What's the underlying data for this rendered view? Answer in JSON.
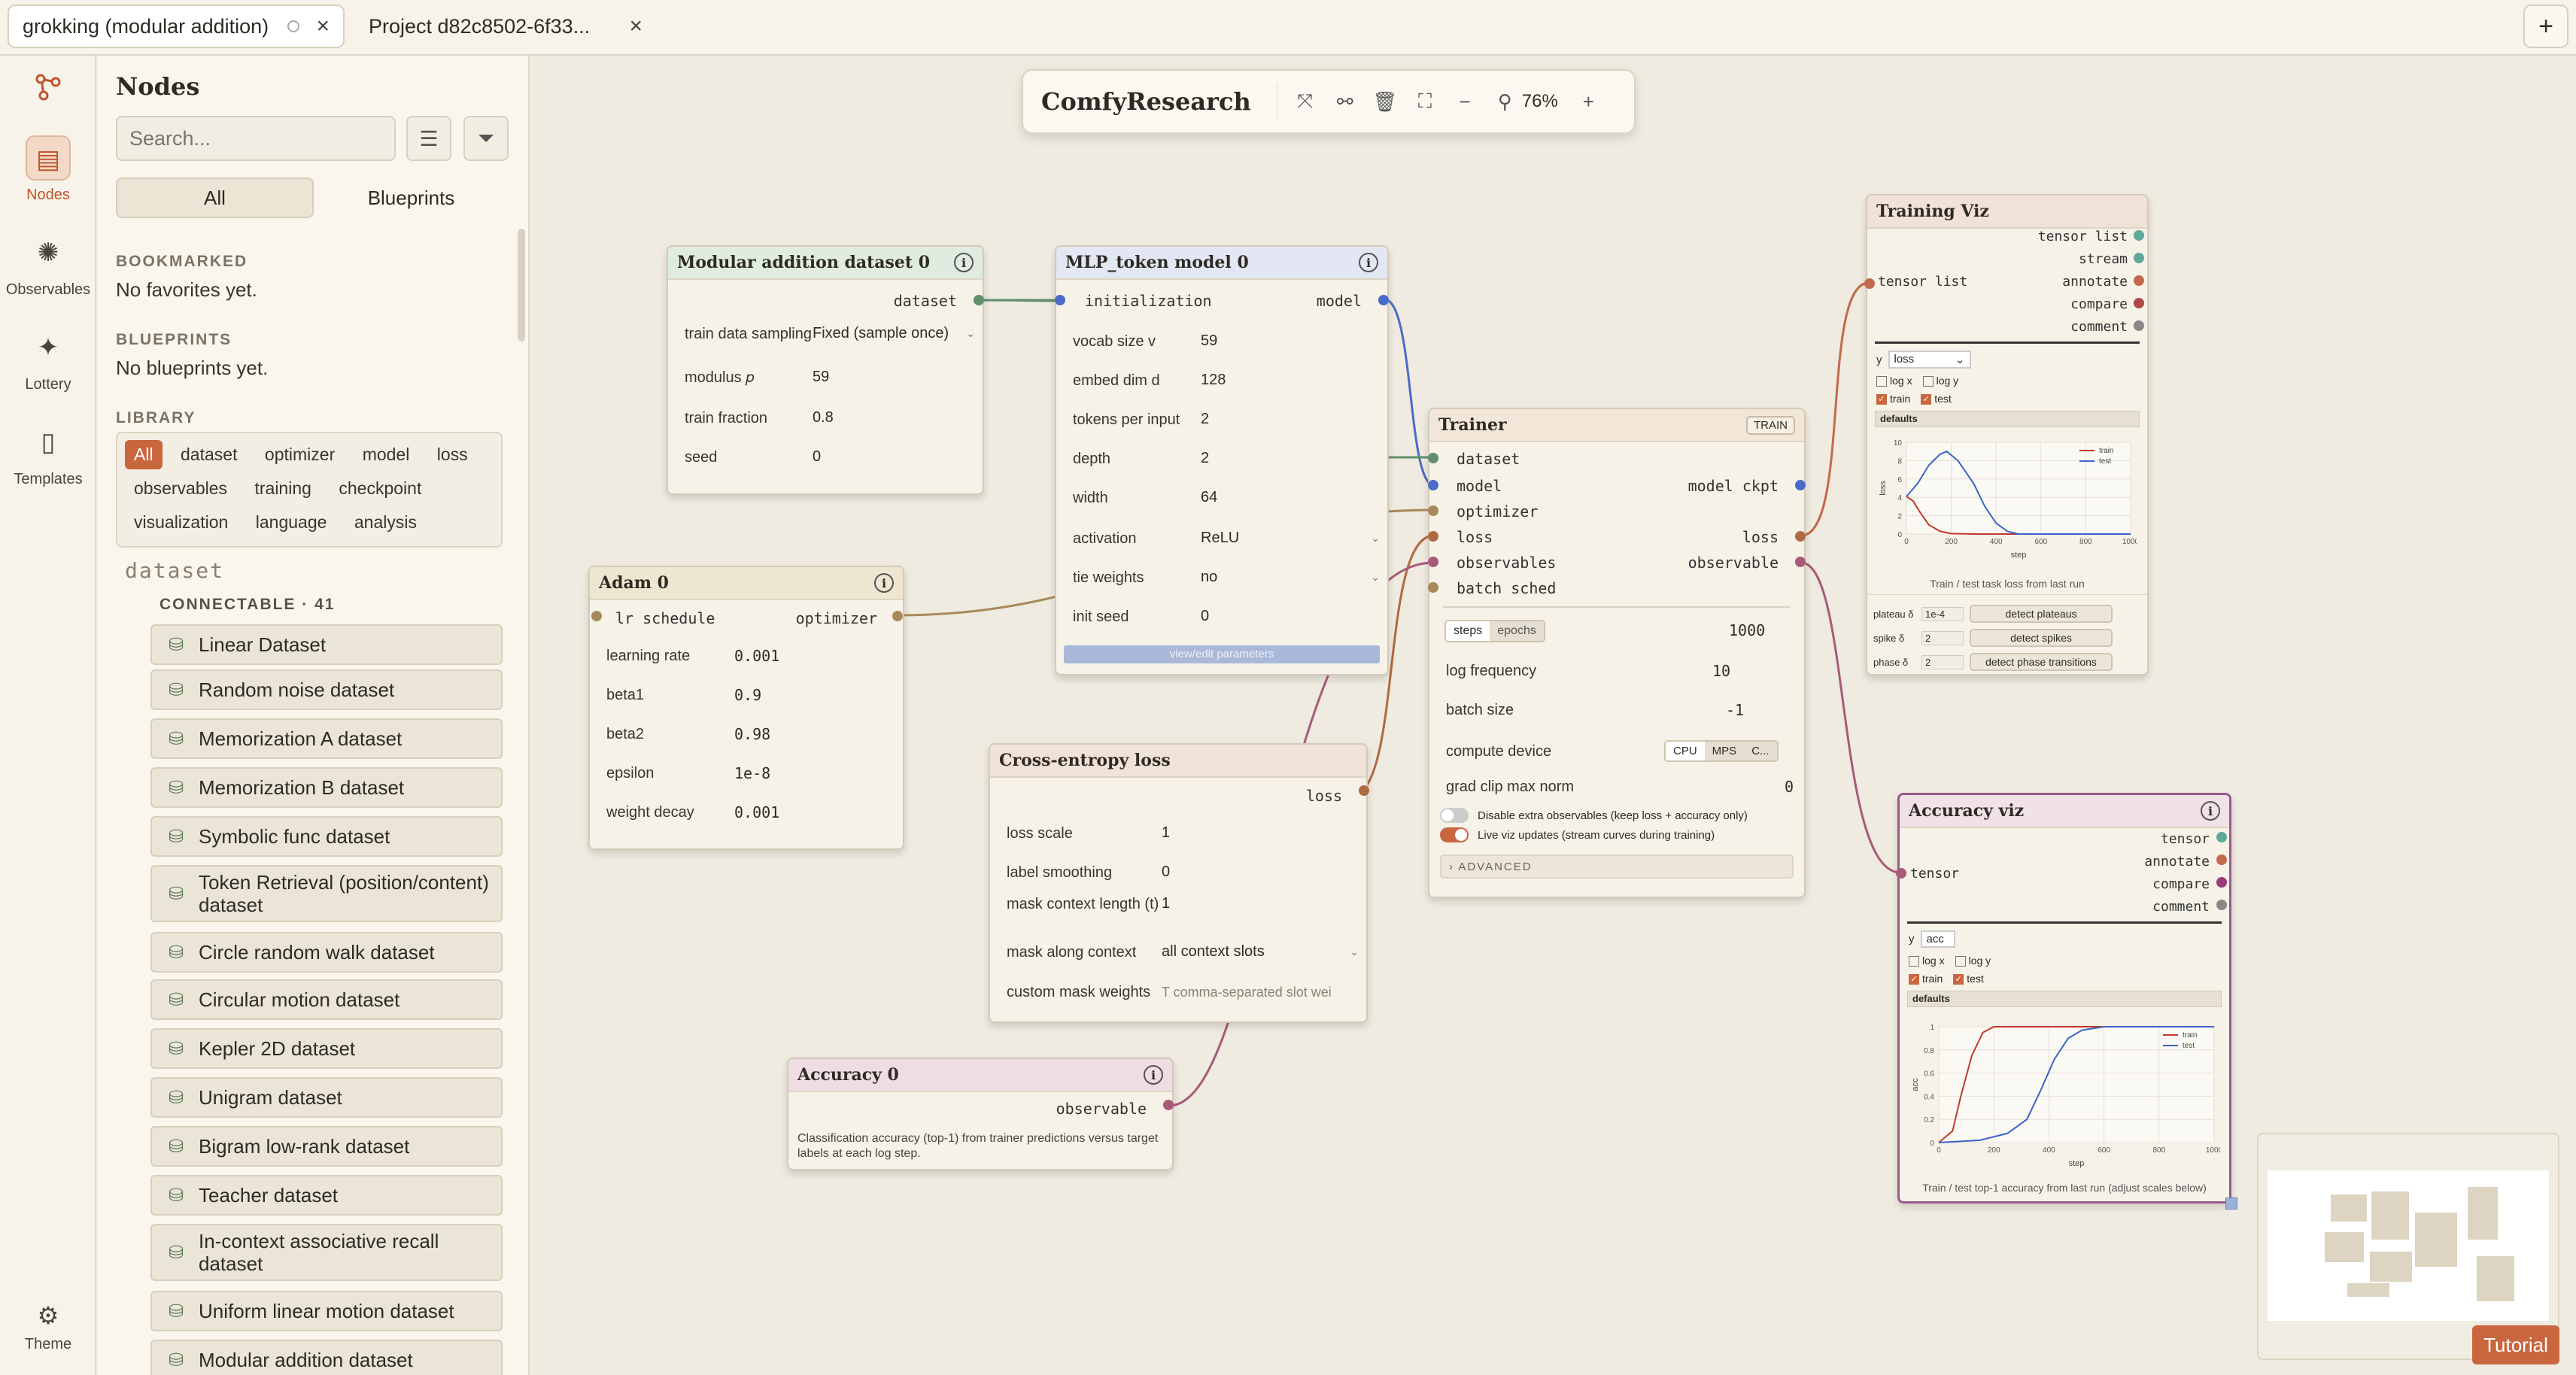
{
  "tabs": [
    {
      "title": "grokking (modular addition)",
      "close": "×"
    },
    {
      "title": "Project d82c8502-6f33...",
      "close": "×"
    }
  ],
  "new_tab": "+",
  "rail": {
    "items": [
      {
        "label": "",
        "icon": "graph-icon"
      },
      {
        "label": "Nodes",
        "icon": "nodes-icon"
      },
      {
        "label": "Observables",
        "icon": "observables-icon"
      },
      {
        "label": "Lottery",
        "icon": "sparkle-icon"
      },
      {
        "label": "Templates",
        "icon": "template-icon"
      }
    ],
    "theme_label": "Theme"
  },
  "sidebar": {
    "title": "Nodes",
    "search_placeholder": "Search...",
    "seg_all": "All",
    "seg_blueprints": "Blueprints",
    "bookmarked_head": "BOOKMARKED",
    "bookmarked_text": "No favorites yet.",
    "blueprints_head": "BLUEPRINTS",
    "blueprints_text": "No blueprints yet.",
    "library_head": "LIBRARY",
    "chips": [
      "All",
      "dataset",
      "optimizer",
      "model",
      "loss",
      "observables",
      "training",
      "checkpoint",
      "visualization",
      "language",
      "analysis"
    ],
    "section": "dataset",
    "connectable": "CONNECTABLE · 41",
    "datasets": [
      "Linear Dataset",
      "Random noise dataset",
      "Memorization A dataset",
      "Memorization B dataset",
      "Symbolic func dataset",
      "Token Retrieval (position/content) dataset",
      "Circle random walk dataset",
      "Circular motion dataset",
      "Kepler 2D dataset",
      "Unigram dataset",
      "Bigram low-rank dataset",
      "Teacher dataset",
      "In-context associative recall dataset",
      "Uniform linear motion dataset",
      "Modular addition dataset"
    ]
  },
  "toolbar": {
    "title": "ComfyResearch",
    "zoom": "76%"
  },
  "nodes": {
    "moddata": {
      "title": "Modular addition dataset 0",
      "out": "dataset",
      "rows": [
        {
          "l": "train data sampling",
          "v": "Fixed (sample once)"
        },
        {
          "l": "modulus 𝑝",
          "v": "59"
        },
        {
          "l": "train fraction",
          "v": "0.8"
        },
        {
          "l": "seed",
          "v": "0"
        }
      ]
    },
    "mlp": {
      "title": "MLP_token model 0",
      "in": "initialization",
      "out": "model",
      "rows": [
        {
          "l": "vocab size v",
          "v": "59"
        },
        {
          "l": "embed dim d",
          "v": "128"
        },
        {
          "l": "tokens per input",
          "v": "2"
        },
        {
          "l": "depth",
          "v": "2"
        },
        {
          "l": "width",
          "v": "64"
        },
        {
          "l": "activation",
          "v": "ReLU"
        },
        {
          "l": "tie weights",
          "v": "no"
        },
        {
          "l": "init seed",
          "v": "0"
        }
      ],
      "button": "view/edit parameters"
    },
    "adam": {
      "title": "Adam 0",
      "in": "lr schedule",
      "out": "optimizer",
      "rows": [
        {
          "l": "learning rate",
          "v": "0.001"
        },
        {
          "l": "beta1",
          "v": "0.9"
        },
        {
          "l": "beta2",
          "v": "0.98"
        },
        {
          "l": "epsilon",
          "v": "1e-8"
        },
        {
          "l": "weight decay",
          "v": "0.001"
        }
      ]
    },
    "ce": {
      "title": "Cross-entropy loss",
      "out": "loss",
      "rows": [
        {
          "l": "loss scale",
          "v": "1"
        },
        {
          "l": "label smoothing",
          "v": "0"
        },
        {
          "l": "mask context length (t)",
          "v": "1"
        },
        {
          "l": "mask along context",
          "v": "all context slots"
        },
        {
          "l": "custom mask weights",
          "v": "T comma-separated slot wei"
        }
      ]
    },
    "acc": {
      "title": "Accuracy 0",
      "out": "observable",
      "desc": "Classification accuracy (top-1) from trainer predictions versus target labels at each log step."
    },
    "trainer": {
      "title": "Trainer",
      "badge": "TRAIN",
      "inputs": [
        "dataset",
        "model",
        "optimizer",
        "loss",
        "observables",
        "batch sched"
      ],
      "outputs": [
        "model ckpt",
        "loss",
        "observable"
      ],
      "steps": "steps",
      "epochs": "epochs",
      "steps_val": "1000",
      "rows": [
        {
          "l": "log frequency",
          "v": "10"
        },
        {
          "l": "batch size",
          "v": "-1"
        }
      ],
      "device_label": "compute device",
      "devices": [
        "CPU",
        "MPS",
        "C..."
      ],
      "clip_label": "grad clip max norm",
      "clip_val": "0",
      "toggle1": "Disable extra observables (keep loss + accuracy only)",
      "toggle2": "Live viz updates (stream curves during training)",
      "advanced": "› ADVANCED"
    },
    "trainviz": {
      "title": "Training Viz",
      "outputs": [
        "tensor list",
        "stream",
        "annotate",
        "compare",
        "comment"
      ],
      "in": "tensor list",
      "y_label": "y",
      "y_value": "loss",
      "logx": "log x",
      "logy": "log y",
      "train": "train",
      "test": "test",
      "defaults": "defaults",
      "caption": "Train / test task loss from last run",
      "plateau": "plateau δ",
      "plateau_v": "1e-4",
      "plateau_btn": "detect plateaus",
      "spike": "spike δ",
      "spike_v": "2",
      "spike_btn": "detect spikes",
      "phase": "phase δ",
      "phase_v": "2",
      "phase_btn": "detect phase transitions"
    },
    "accviz": {
      "title": "Accuracy viz",
      "outputs": [
        "tensor",
        "annotate",
        "compare",
        "comment"
      ],
      "in": "tensor",
      "y_label": "y",
      "y_value": "acc",
      "logx": "log x",
      "logy": "log y",
      "train": "train",
      "test": "test",
      "defaults": "defaults",
      "caption": "Train / test top-1 accuracy from last run (adjust scales below)"
    }
  },
  "chart_data": [
    {
      "type": "line",
      "xlabel": "step",
      "ylabel": "loss",
      "xlim": [
        0,
        1000
      ],
      "ylim": [
        0,
        10
      ],
      "xticks": [
        0,
        200,
        400,
        600,
        800,
        1000
      ],
      "yticks": [
        0,
        2,
        4,
        6,
        8,
        10
      ],
      "legend": "top-right",
      "series": [
        {
          "name": "train",
          "color": "#c0392b",
          "x": [
            0,
            30,
            60,
            100,
            150,
            200,
            300,
            1000
          ],
          "y": [
            4.1,
            3.6,
            2.4,
            1.0,
            0.3,
            0.05,
            0.0,
            0.0
          ]
        },
        {
          "name": "test",
          "color": "#3b63c9",
          "x": [
            0,
            50,
            100,
            150,
            180,
            230,
            300,
            350,
            400,
            450,
            500,
            1000
          ],
          "y": [
            4.1,
            5.5,
            7.5,
            8.7,
            9.0,
            8.0,
            5.5,
            3.0,
            1.2,
            0.3,
            0.0,
            0.0
          ]
        }
      ]
    },
    {
      "type": "line",
      "xlabel": "step",
      "ylabel": "acc",
      "xlim": [
        0,
        1000
      ],
      "ylim": [
        0,
        1
      ],
      "xticks": [
        0,
        200,
        400,
        600,
        800,
        1000
      ],
      "yticks": [
        0,
        0.2,
        0.4,
        0.6,
        0.8,
        1
      ],
      "legend": "top-right",
      "series": [
        {
          "name": "train",
          "color": "#c0392b",
          "x": [
            0,
            50,
            80,
            120,
            160,
            200,
            1000
          ],
          "y": [
            0.0,
            0.1,
            0.4,
            0.75,
            0.95,
            1.0,
            1.0
          ]
        },
        {
          "name": "test",
          "color": "#3b63c9",
          "x": [
            0,
            150,
            250,
            320,
            370,
            420,
            470,
            520,
            600,
            1000
          ],
          "y": [
            0.0,
            0.02,
            0.08,
            0.2,
            0.45,
            0.72,
            0.9,
            0.97,
            1.0,
            1.0
          ]
        }
      ]
    }
  ]
}
